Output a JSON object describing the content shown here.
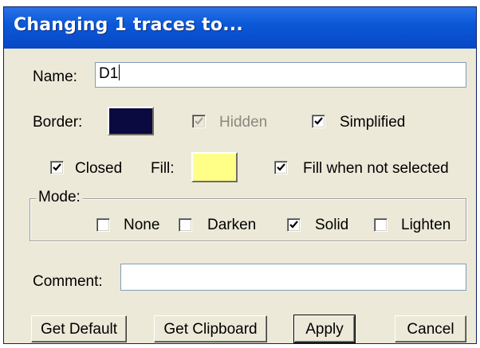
{
  "window": {
    "title": "Changing 1 traces to..."
  },
  "name": {
    "label": "Name:",
    "value": "D1"
  },
  "border": {
    "label": "Border:",
    "color": "#0a0a40"
  },
  "hidden": {
    "label": "Hidden",
    "checked": true,
    "enabled": false
  },
  "simplified": {
    "label": "Simplified",
    "checked": true
  },
  "closed": {
    "label": "Closed",
    "checked": true
  },
  "fill": {
    "label": "Fill:",
    "color": "#ffff88"
  },
  "fill_when_not_selected": {
    "label": "Fill when not selected",
    "checked": true
  },
  "mode": {
    "label": "Mode:",
    "options": [
      {
        "label": "None",
        "checked": false
      },
      {
        "label": "Darken",
        "checked": false
      },
      {
        "label": "Solid",
        "checked": true
      },
      {
        "label": "Lighten",
        "checked": false
      }
    ]
  },
  "comment": {
    "label": "Comment:",
    "value": ""
  },
  "buttons": {
    "get_default": "Get Default",
    "get_clipboard": "Get Clipboard",
    "apply": "Apply",
    "cancel": "Cancel"
  }
}
